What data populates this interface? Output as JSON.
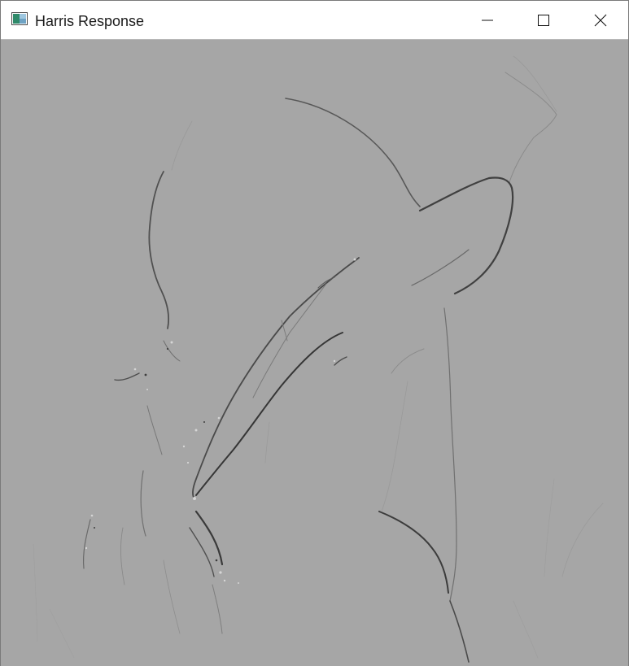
{
  "window": {
    "title": "Harris Response",
    "controls": {
      "minimize": "minimize-icon",
      "maximize": "maximize-icon",
      "close": "close-icon"
    }
  },
  "colors": {
    "titlebar_bg": "#ffffff",
    "image_bg": "#a6a6a6",
    "edge_dark": "#3a3a3a",
    "edge_light": "#d8d8d8"
  }
}
